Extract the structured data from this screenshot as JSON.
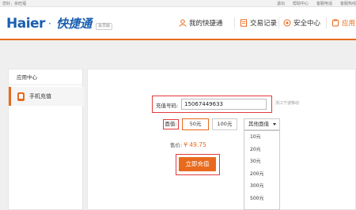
{
  "topbar": {
    "greeting": "您好，余旺福",
    "links": [
      "退出",
      "帮助中心",
      "客服电话",
      "客服热线"
    ]
  },
  "header": {
    "logo_text": "Haier",
    "logo_dot": "·",
    "logo_cn": "快捷通",
    "logo_badge": "会员版",
    "nav": [
      {
        "label": "我的快捷通",
        "icon": "person-icon"
      },
      {
        "label": "交易记录",
        "icon": "document-icon"
      },
      {
        "label": "安全中心",
        "icon": "shield-icon"
      },
      {
        "label": "应用",
        "icon": "app-icon"
      }
    ],
    "accent_color": "#e96a1d"
  },
  "sidebar": {
    "heading": "应用中心",
    "items": [
      {
        "label": "手机充值",
        "icon": "phone-icon",
        "active": true
      }
    ]
  },
  "form": {
    "phone_label": "充值号码:",
    "phone_value": "15067449633",
    "carrier": "浙江宁波移动",
    "denom_label": "面值:",
    "denoms": [
      {
        "label": "50元",
        "selected": true
      },
      {
        "label": "100元",
        "selected": false
      }
    ],
    "other_label": "其他面值",
    "dropdown_options": [
      "10元",
      "20元",
      "30元",
      "200元",
      "300元",
      "500元"
    ],
    "price_label": "售价:",
    "price_value": "¥ 49.75",
    "submit_label": "立即充值",
    "highlight_color": "#e23b3b"
  }
}
